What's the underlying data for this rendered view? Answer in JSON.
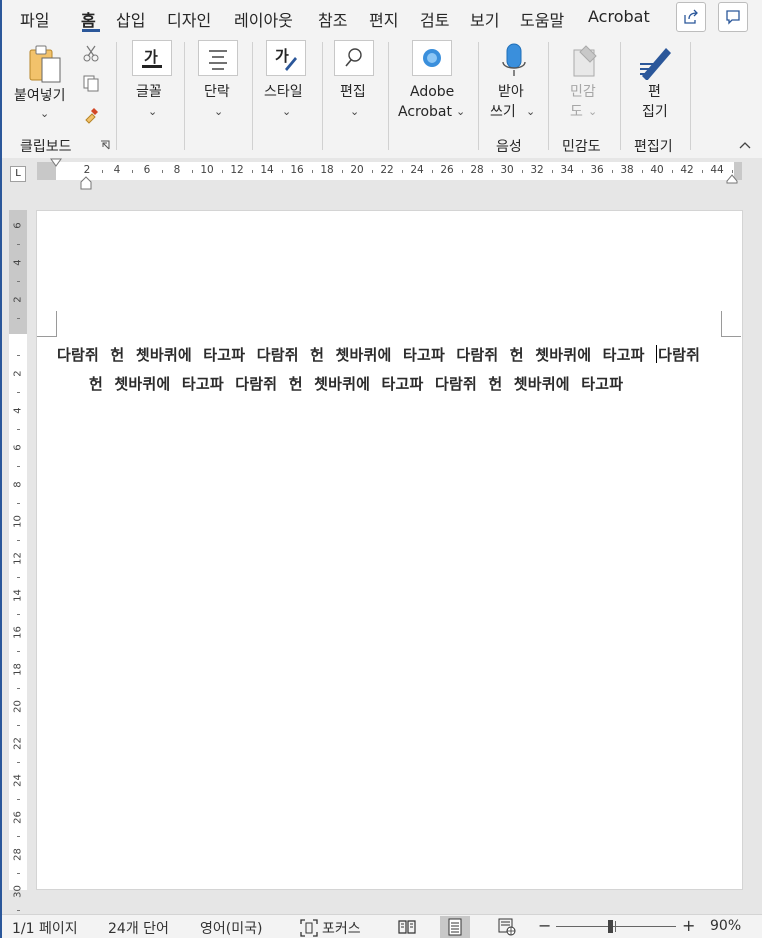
{
  "menu": {
    "tabs": [
      "파일",
      "홈",
      "삽입",
      "디자인",
      "레이아웃",
      "참조",
      "편지",
      "검토",
      "보기",
      "도움말",
      "Acrobat"
    ],
    "active": "홈"
  },
  "ribbon": {
    "clipboard": {
      "paste_label": "붙여넣기",
      "group": "클립보드"
    },
    "font_label": "글꼴",
    "font_icon_text": "가",
    "paragraph_label": "단락",
    "styles_label": "스타일",
    "styles_icon_text": "가",
    "editing_label": "편집",
    "acrobat": {
      "line1": "Adobe",
      "line2": "Acrobat"
    },
    "dictate": {
      "line1": "받아",
      "line2": "쓰기",
      "group": "음성"
    },
    "sensitivity": {
      "line1": "민감",
      "line2": "도",
      "group": "민감도"
    },
    "editor": {
      "line1": "편",
      "line2": "집기",
      "group": "편집기"
    },
    "chevron": "⌄"
  },
  "ruler": {
    "numbers": [
      "2",
      "4",
      "6",
      "8",
      "10",
      "12",
      "14",
      "16",
      "18",
      "20",
      "22",
      "24",
      "26",
      "28",
      "30",
      "32",
      "34",
      "36",
      "38",
      "40",
      "42",
      "44"
    ],
    "tab_symbol": "L"
  },
  "vruler": {
    "numbers": [
      "6",
      "4",
      "2",
      "",
      "2",
      "4",
      "6",
      "8",
      "10",
      "12",
      "14",
      "16",
      "18",
      "20",
      "22",
      "24",
      "26",
      "28",
      "30"
    ]
  },
  "document": {
    "line1_before_cursor": "다람쥐 헌 쳇바퀴에 타고파 다람쥐 헌 쳇바퀴에 타고파 다람쥐 헌 쳇바퀴에 타고파",
    "line1_after_cursor": "다람쥐",
    "line2": "헌 쳇바퀴에 타고파 다람쥐 헌 쳇바퀴에 타고파 다람쥐 헌 쳇바퀴에 타고파"
  },
  "status": {
    "page": "1/1 페이지",
    "words": "24개 단어",
    "language": "영어(미국)",
    "focus": "포커스",
    "zoom_minus": "−",
    "zoom_plus": "+",
    "zoom": "90%",
    "zoom_level": 0.9
  }
}
